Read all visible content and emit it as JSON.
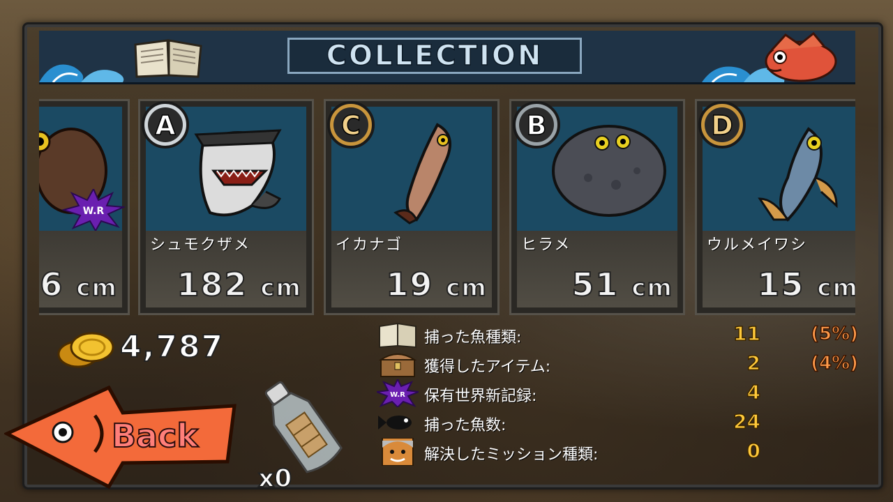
{
  "header": {
    "title": "COLLECTION"
  },
  "cards": [
    {
      "rank": "",
      "name": "",
      "size": "6",
      "unit": "cm",
      "badge": "W.R"
    },
    {
      "rank": "A",
      "name": "シュモクザメ",
      "size": "182",
      "unit": "cm"
    },
    {
      "rank": "C",
      "name": "イカナゴ",
      "size": "19",
      "unit": "cm"
    },
    {
      "rank": "B",
      "name": "ヒラメ",
      "size": "51",
      "unit": "cm"
    },
    {
      "rank": "D",
      "name": "ウルメイワシ",
      "size": "15",
      "unit": "cm"
    }
  ],
  "coins": {
    "count": "4,787"
  },
  "back_button": {
    "label": "Back"
  },
  "bottle": {
    "count": "x0"
  },
  "stats": [
    {
      "icon": "book-icon",
      "label": "捕った魚種類:",
      "value": "11",
      "pct": "(5%)"
    },
    {
      "icon": "treasure-chest-icon",
      "label": "獲得したアイテム:",
      "value": "2",
      "pct": "(4%)"
    },
    {
      "icon": "world-record-icon",
      "badge": "W.R",
      "label": "保有世界新記録:",
      "value": "4",
      "pct": ""
    },
    {
      "icon": "fish-silhouette-icon",
      "label": "捕った魚数:",
      "value": "24",
      "pct": ""
    },
    {
      "icon": "captain-portrait-icon",
      "label": "解決したミッション種類:",
      "value": "0",
      "pct": ""
    }
  ],
  "colors": {
    "header_bg": "#1f3346",
    "card_blue": "#1b4a63",
    "stat_value": "#ffc93a",
    "stat_pct": "#ff9a4a",
    "back_arrow": "#f36a3a"
  }
}
